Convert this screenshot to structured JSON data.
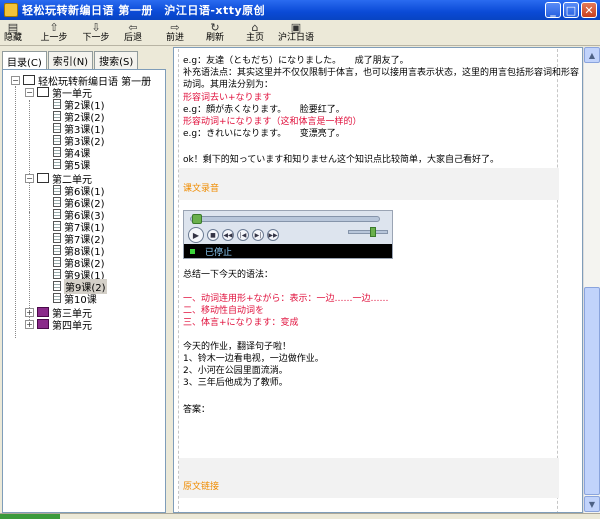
{
  "window": {
    "title": "轻松玩转新编日语 第一册　沪江日语-xtty原创",
    "minimize": "_",
    "maximize": "□",
    "close": "✕"
  },
  "toolbar": [
    {
      "label": "隐藏",
      "icon": "hide-icon",
      "glyph": "▤"
    },
    {
      "label": "上一步",
      "icon": "arrow-up-icon",
      "glyph": "⇧"
    },
    {
      "label": "下一步",
      "icon": "arrow-down-icon",
      "glyph": "⇩"
    },
    {
      "label": "后退",
      "icon": "arrow-back-icon",
      "glyph": "⇦"
    },
    {
      "label": "前进",
      "icon": "arrow-forward-icon",
      "glyph": "⇨"
    },
    {
      "label": "刷新",
      "icon": "refresh-icon",
      "glyph": "↻"
    },
    {
      "label": "主页",
      "icon": "home-icon",
      "glyph": "⌂"
    },
    {
      "label": "沪江日语",
      "icon": "page-icon",
      "glyph": "▣"
    }
  ],
  "tabs": [
    {
      "label": "目录(C)",
      "active": true
    },
    {
      "label": "索引(N)",
      "active": false
    },
    {
      "label": "搜索(S)",
      "active": false
    }
  ],
  "tree": {
    "root": "轻松玩转新编日语 第一册",
    "unit1": "第一单元",
    "unit1_lessons": [
      "第2课(1)",
      "第2课(2)",
      "第3课(1)",
      "第3课(2)",
      "第4课",
      "第5课"
    ],
    "unit2": "第二单元",
    "unit2_lessons": [
      "第6课(1)",
      "第6课(2)",
      "第6课(3)",
      "第7课(1)",
      "第7课(2)",
      "第8课(1)",
      "第8课(2)",
      "第9课(1)",
      "第9课(2)",
      "第10课"
    ],
    "selected": "第9课(2)",
    "unit3": "第三单元",
    "unit4": "第四单元"
  },
  "content": {
    "l1": "e.g：友達（ともだち）になりました。　　成了朋友了。",
    "l2": "补充语法点：其实这里并不仅仅限制于体言，也可以接用言表示状态，这里的用言包括形容词和形容",
    "l3": "动词。其用法分别为：",
    "l4": "形容词去い+なります",
    "l5": "e.g：顔が赤くなります。　　脸要红了。",
    "l6": "形容动词+になります（这和体言是一样的）",
    "l7": "e.g：きれいになります。　　变漂亮了。",
    "l8": "ok！剩下的知っています和知りません这个知识点比较简单，大家自己看好了。",
    "recording_title": "课文录音",
    "player_status": "已停止",
    "summary": "总结一下今天的语法：",
    "g1": "一、动词连用形+ながら：表示：一边……一边……",
    "g2": "二、移动性自动词を",
    "g3": "三、体言+になります：变成",
    "hw_title": "今天的作业，翻译句子啦！",
    "hw1": "1、铃木一边看电视，一边做作业。",
    "hw2": "2、小河在公园里面流淌。",
    "hw3": "3、三年后他成为了教师。",
    "answer": "答案：",
    "original_link": "原文链接"
  }
}
